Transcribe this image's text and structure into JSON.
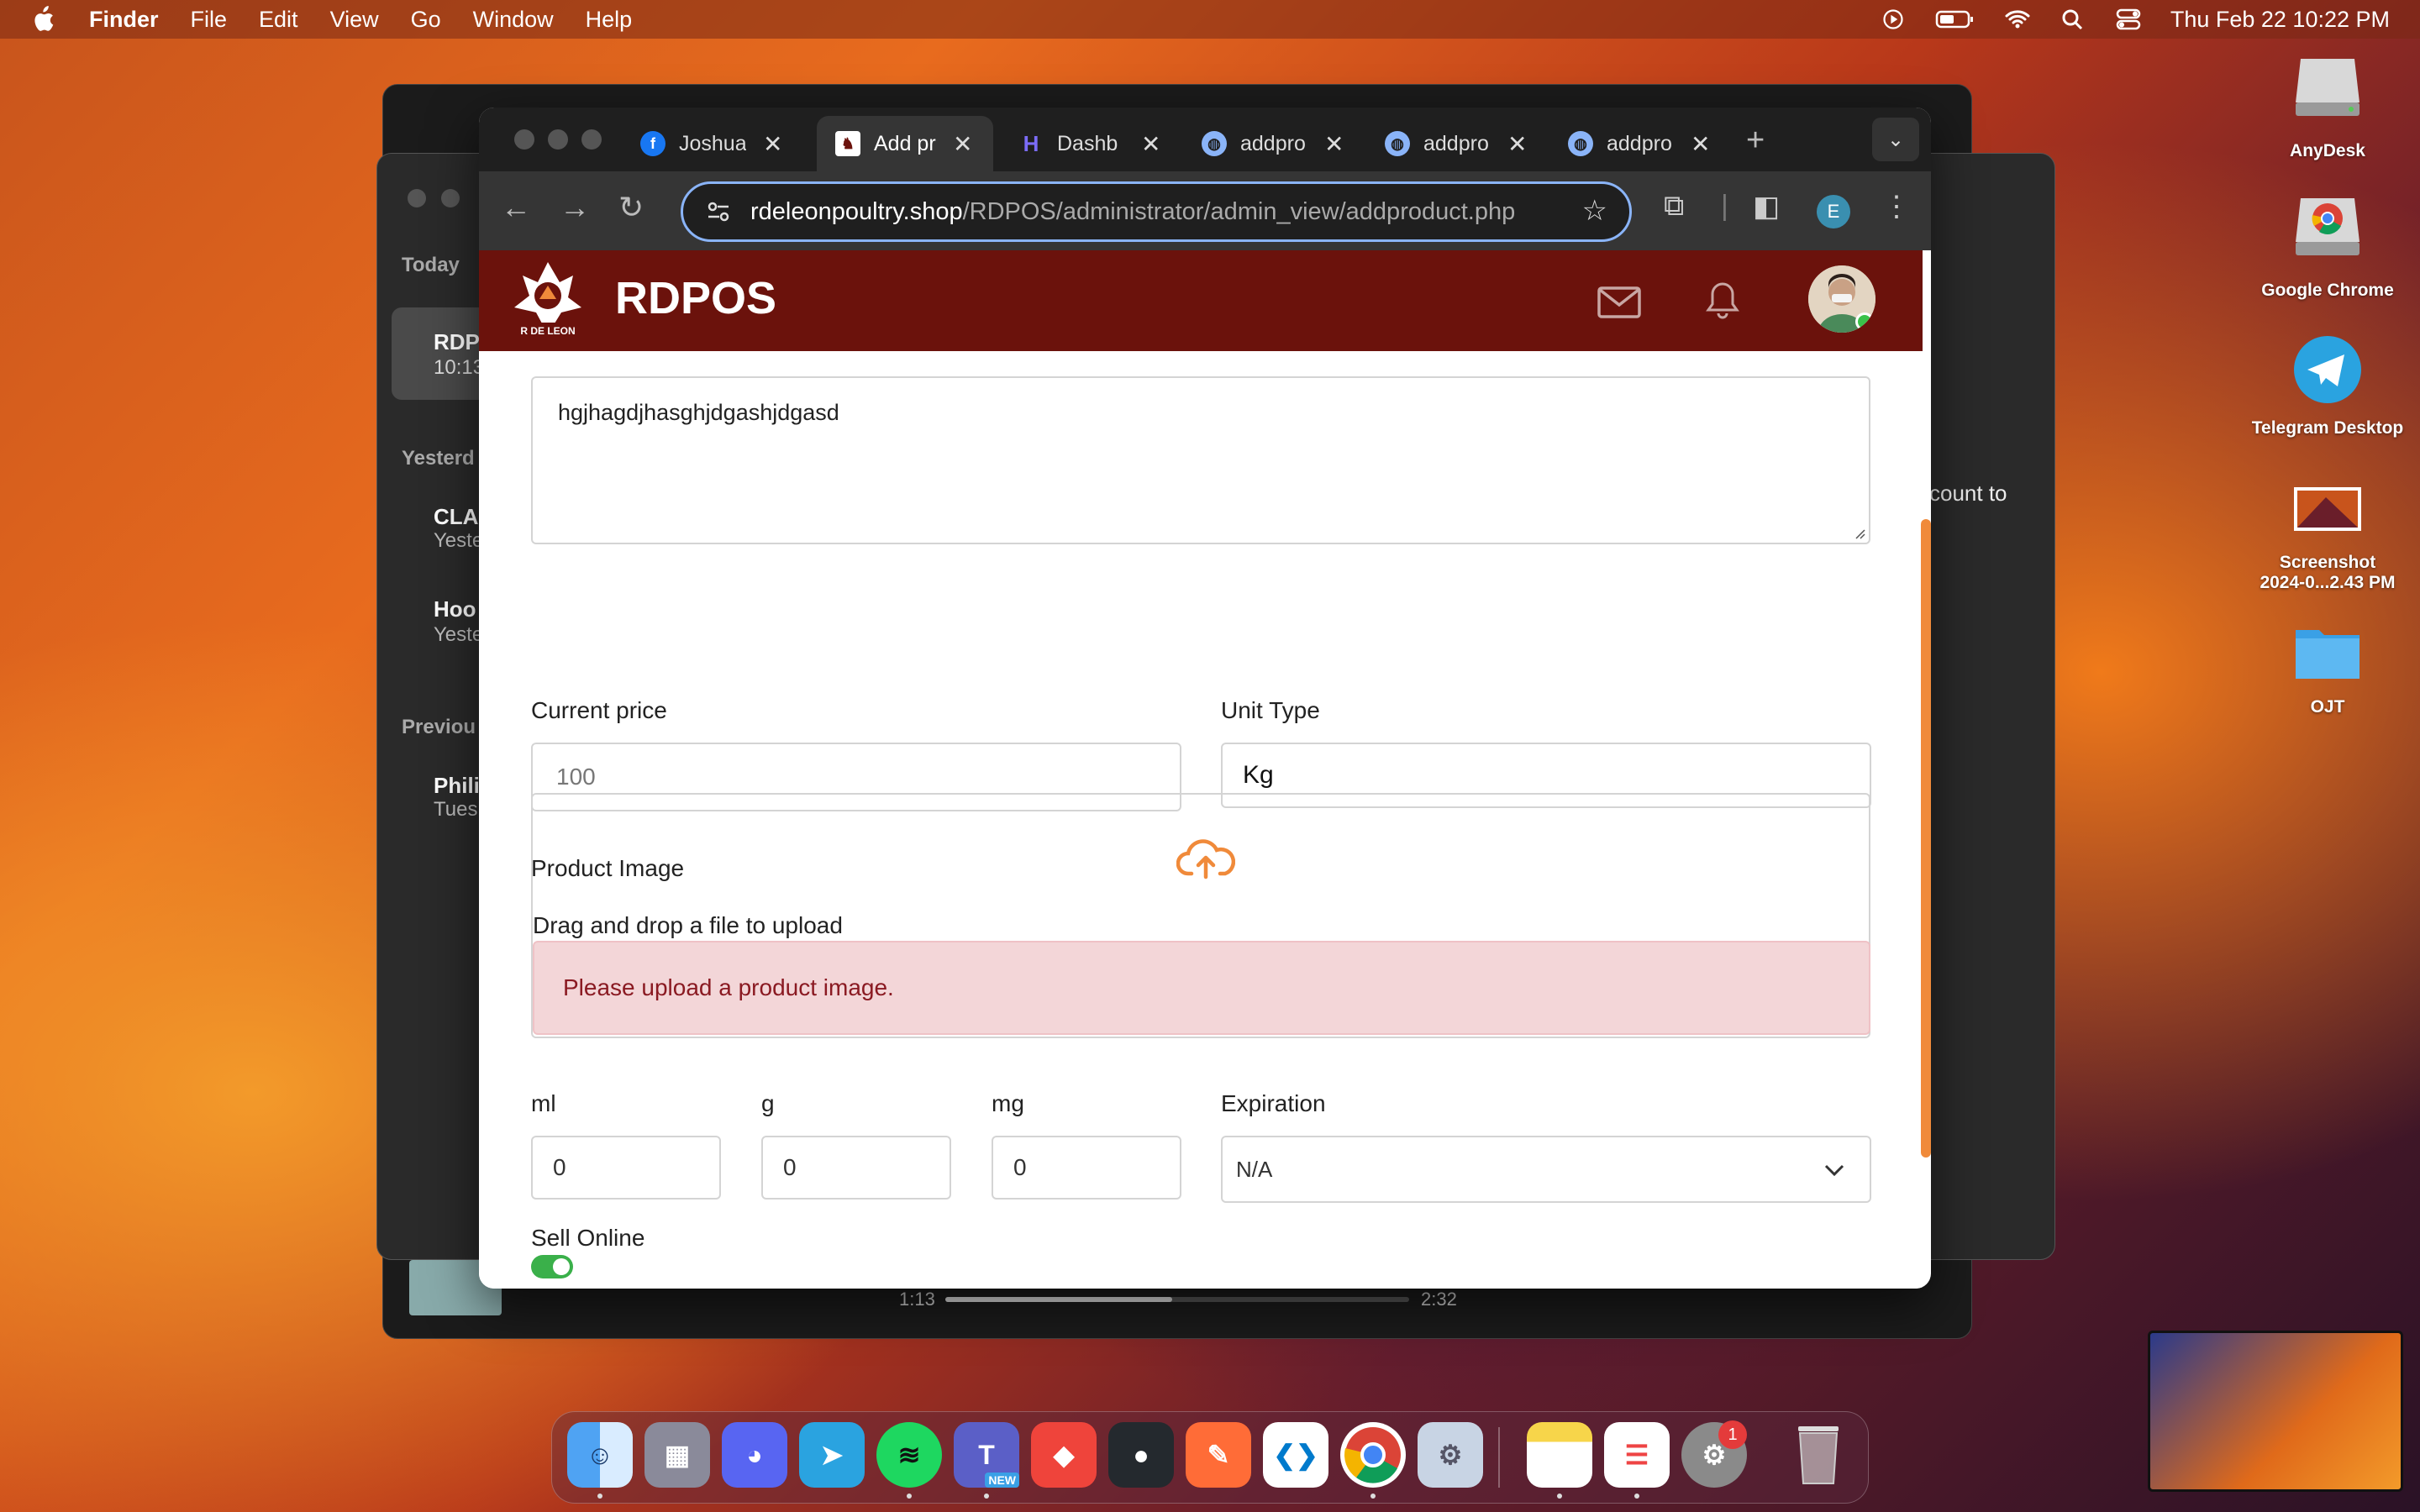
{
  "menubar": {
    "app": "Finder",
    "items": [
      "File",
      "Edit",
      "View",
      "Go",
      "Window",
      "Help"
    ],
    "clock": "Thu Feb 22  10:22 PM"
  },
  "messages_sidebar": {
    "today": "Today",
    "item1_title": "RDP",
    "item1_time": "10:13",
    "yesterday": "Yesterd",
    "item2_title": "CLA",
    "item2_sub": "Yeste",
    "item3_title": "Hoo",
    "item3_sub": "Yeste",
    "previous": "Previou",
    "item4_title": "Phili",
    "item4_sub": "Tues",
    "peek_text": "count to"
  },
  "player": {
    "elapsed": "1:13",
    "total": "2:32",
    "progress": 0.49
  },
  "browser": {
    "tabs": [
      {
        "label": "Joshua",
        "icon": "facebook-icon"
      },
      {
        "label": "Add pr",
        "icon": "rdpos-icon"
      },
      {
        "label": "Dashb",
        "icon": "dashboard-icon"
      },
      {
        "label": "addpro",
        "icon": "globe-icon"
      },
      {
        "label": "addpro",
        "icon": "globe-icon"
      },
      {
        "label": "addpro",
        "icon": "globe-icon"
      }
    ],
    "url_host": "rdeleonpoultry.shop",
    "url_path": "/RDPOS/administrator/admin_view/addproduct.php",
    "profile_initial": "E"
  },
  "app": {
    "brand": "RDPOS",
    "logo_text": "R DE LEON",
    "header_color": "#6b120c"
  },
  "form": {
    "description_value": "hgjhagdjhasghjdgashjdgasd",
    "current_price_label": "Current price",
    "current_price_placeholder": "100",
    "unit_type_label": "Unit Type",
    "unit_type_value": "Kg",
    "product_image_label": "Product Image",
    "dropzone_text": "Drag and drop a file to upload",
    "image_error": "Please upload a product image.",
    "ml_label": "ml",
    "ml_value": "0",
    "g_label": "g",
    "g_value": "0",
    "mg_label": "mg",
    "mg_value": "0",
    "expiration_label": "Expiration",
    "expiration_value": "N/A",
    "sell_online_label": "Sell Online",
    "sell_online_on": true
  },
  "desktop_icons": [
    {
      "label": "AnyDesk"
    },
    {
      "label": "Google Chrome"
    },
    {
      "label": "Telegram Desktop"
    },
    {
      "label": "Screenshot",
      "label2": "2024-0...2.43 PM"
    },
    {
      "label": "OJT"
    }
  ],
  "dock": {
    "apps": [
      "Finder",
      "Launchpad",
      "Discord",
      "Telegram",
      "Spotify",
      "Microsoft Teams",
      "AnyDesk",
      "GitHub Desktop",
      "Postman",
      "Visual Studio Code",
      "Google Chrome",
      "Preview",
      "Notes",
      "Reminders",
      "System Settings",
      "Trash"
    ],
    "teams_badge": "NEW",
    "settings_badge": "1"
  }
}
